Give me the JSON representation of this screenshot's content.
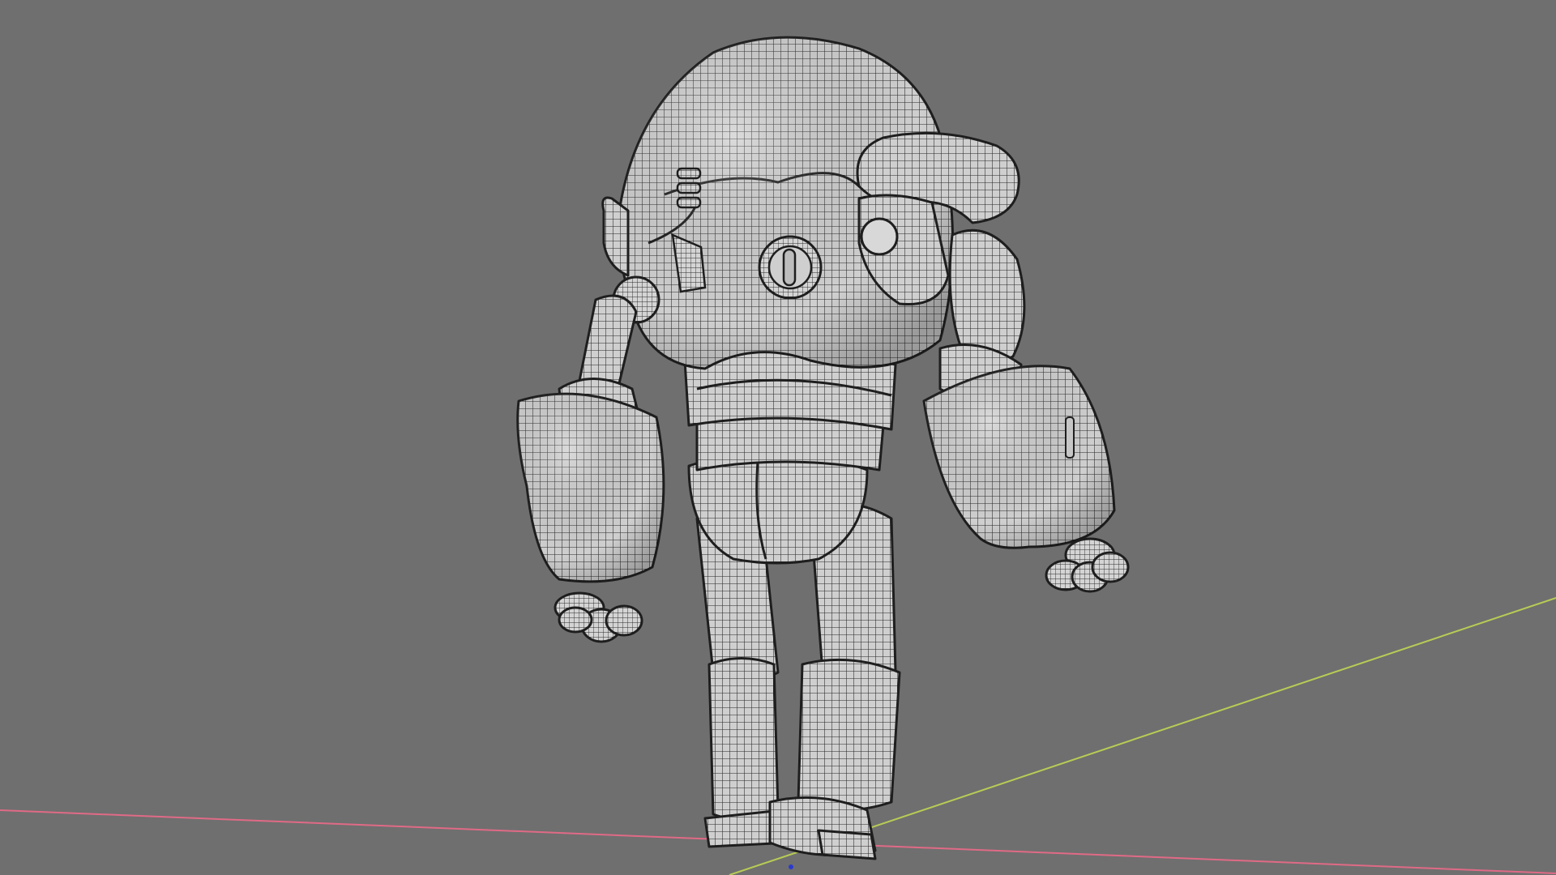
{
  "viewport": {
    "background_color": "#6f6f6f",
    "shading_mode": "wireframe-on-solid",
    "axes": {
      "x_axis_color": "#e06a86",
      "y_axis_color": "#b7cc55",
      "z_origin_color": "#2a3ad0"
    },
    "model": {
      "subject": "robot-character",
      "mesh_fill_color": "#cfcfcf",
      "wire_color": "#262626"
    }
  }
}
